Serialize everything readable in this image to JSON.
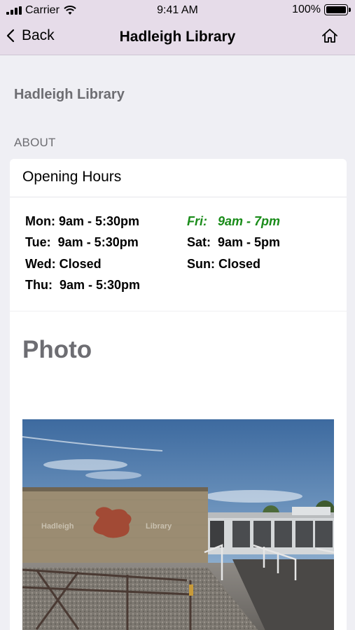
{
  "status": {
    "carrier": "Carrier",
    "time": "9:41 AM",
    "battery": "100%"
  },
  "nav": {
    "back_label": "Back",
    "title": "Hadleigh Library"
  },
  "page": {
    "title": "Hadleigh Library",
    "section": "ABOUT"
  },
  "opening_hours": {
    "title": "Opening Hours",
    "left": [
      {
        "text": "Mon: 9am - 5:30pm"
      },
      {
        "text": "Tue:  9am - 5:30pm"
      },
      {
        "text": "Wed: Closed"
      },
      {
        "text": "Thu:  9am - 5:30pm"
      }
    ],
    "right": [
      {
        "text": "Fri:   9am - 7pm",
        "highlight": true
      },
      {
        "text": "Sat:  9am - 5pm"
      },
      {
        "text": "Sun: Closed"
      }
    ]
  },
  "photo": {
    "title": "Photo",
    "sign_left": "Hadleigh",
    "sign_right": "Library"
  },
  "colors": {
    "nav_bg": "#e6dce9",
    "highlight": "#1a8c1a",
    "secondary_text": "#6d6d72"
  }
}
